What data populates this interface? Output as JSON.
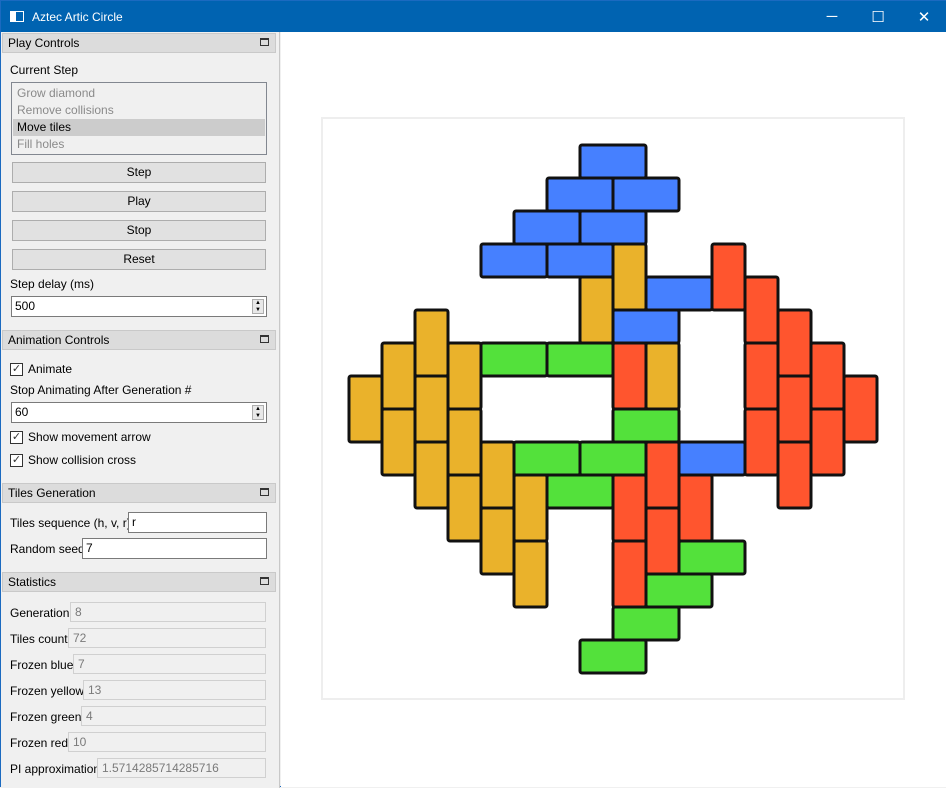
{
  "window": {
    "title": "Aztec Artic Circle",
    "minimize": "─",
    "maximize": "☐",
    "close": "✕"
  },
  "play_controls": {
    "header": "Play Controls",
    "current_step_label": "Current Step",
    "steps": [
      {
        "label": "Grow diamond",
        "selected": false
      },
      {
        "label": "Remove collisions",
        "selected": false
      },
      {
        "label": "Move tiles",
        "selected": true
      },
      {
        "label": "Fill holes",
        "selected": false
      }
    ],
    "step": "Step",
    "play": "Play",
    "stop": "Stop",
    "reset": "Reset",
    "step_delay_label": "Step delay (ms)",
    "step_delay": "500"
  },
  "animation_controls": {
    "header": "Animation Controls",
    "animate": "Animate",
    "animate_checked": true,
    "stop_after_label": "Stop Animating After Generation #",
    "stop_after": "60",
    "show_arrow": "Show movement arrow",
    "show_arrow_checked": true,
    "show_cross": "Show collision cross",
    "show_cross_checked": true
  },
  "tiles_generation": {
    "header": "Tiles Generation",
    "sequence_label": "Tiles sequence (h, v, r)",
    "sequence": "r",
    "seed_label": "Random seed",
    "seed": "7"
  },
  "statistics": {
    "header": "Statistics",
    "generation_label": "Generation",
    "generation": "8",
    "tiles_count_label": "Tiles count",
    "tiles_count": "72",
    "frozen_blue_label": "Frozen blue",
    "frozen_blue": "7",
    "frozen_yellow_label": "Frozen yellow",
    "frozen_yellow": "13",
    "frozen_green_label": "Frozen green",
    "frozen_green": "4",
    "frozen_red_label": "Frozen red",
    "frozen_red": "10",
    "pi_label": "PI approximation",
    "pi": "1.5714285714285716"
  },
  "colors": {
    "blue": "#4680ff",
    "yellow": "#eab22b",
    "green": "#53e13b",
    "red": "#ff552e",
    "accent": "#0063b1"
  },
  "board": {
    "size": 16,
    "tiles": [
      {
        "c": "blue",
        "col": 7,
        "row": 0,
        "o": "h"
      },
      {
        "c": "blue",
        "col": 6,
        "row": 1,
        "o": "h"
      },
      {
        "c": "blue",
        "col": 8,
        "row": 1,
        "o": "h"
      },
      {
        "c": "blue",
        "col": 5,
        "row": 2,
        "o": "h"
      },
      {
        "c": "blue",
        "col": 7,
        "row": 2,
        "o": "h"
      },
      {
        "c": "blue",
        "col": 4,
        "row": 3,
        "o": "h"
      },
      {
        "c": "blue",
        "col": 6,
        "row": 3,
        "o": "h"
      },
      {
        "c": "blue",
        "col": 9,
        "row": 4,
        "o": "h"
      },
      {
        "c": "blue",
        "col": 8,
        "row": 5,
        "o": "h"
      },
      {
        "c": "blue",
        "col": 10,
        "row": 9,
        "o": "h"
      },
      {
        "c": "yellow",
        "col": 8,
        "row": 3,
        "o": "v"
      },
      {
        "c": "yellow",
        "col": 7,
        "row": 4,
        "o": "v"
      },
      {
        "c": "yellow",
        "col": 2,
        "row": 5,
        "o": "v"
      },
      {
        "c": "yellow",
        "col": 1,
        "row": 6,
        "o": "v"
      },
      {
        "c": "yellow",
        "col": 3,
        "row": 6,
        "o": "v"
      },
      {
        "c": "yellow",
        "col": 9,
        "row": 6,
        "o": "v"
      },
      {
        "c": "yellow",
        "col": 0,
        "row": 7,
        "o": "v"
      },
      {
        "c": "yellow",
        "col": 2,
        "row": 7,
        "o": "v"
      },
      {
        "c": "yellow",
        "col": 1,
        "row": 8,
        "o": "v"
      },
      {
        "c": "yellow",
        "col": 3,
        "row": 8,
        "o": "v"
      },
      {
        "c": "yellow",
        "col": 2,
        "row": 9,
        "o": "v"
      },
      {
        "c": "yellow",
        "col": 4,
        "row": 9,
        "o": "v"
      },
      {
        "c": "yellow",
        "col": 3,
        "row": 10,
        "o": "v"
      },
      {
        "c": "yellow",
        "col": 5,
        "row": 10,
        "o": "v"
      },
      {
        "c": "yellow",
        "col": 4,
        "row": 11,
        "o": "v"
      },
      {
        "c": "yellow",
        "col": 5,
        "row": 12,
        "o": "v"
      },
      {
        "c": "green",
        "col": 4,
        "row": 6,
        "o": "h"
      },
      {
        "c": "green",
        "col": 6,
        "row": 6,
        "o": "h"
      },
      {
        "c": "green",
        "col": 8,
        "row": 8,
        "o": "h"
      },
      {
        "c": "green",
        "col": 5,
        "row": 9,
        "o": "h"
      },
      {
        "c": "green",
        "col": 7,
        "row": 9,
        "o": "h"
      },
      {
        "c": "green",
        "col": 6,
        "row": 10,
        "o": "h"
      },
      {
        "c": "green",
        "col": 10,
        "row": 12,
        "o": "h"
      },
      {
        "c": "green",
        "col": 9,
        "row": 13,
        "o": "h"
      },
      {
        "c": "green",
        "col": 8,
        "row": 14,
        "o": "h"
      },
      {
        "c": "green",
        "col": 7,
        "row": 15,
        "o": "h"
      },
      {
        "c": "red",
        "col": 11,
        "row": 3,
        "o": "v"
      },
      {
        "c": "red",
        "col": 12,
        "row": 4,
        "o": "v"
      },
      {
        "c": "red",
        "col": 12,
        "row": 6,
        "o": "v"
      },
      {
        "c": "red",
        "col": 12,
        "row": 8,
        "o": "v"
      },
      {
        "c": "red",
        "col": 13,
        "row": 5,
        "o": "v"
      },
      {
        "c": "red",
        "col": 13,
        "row": 7,
        "o": "v"
      },
      {
        "c": "red",
        "col": 13,
        "row": 9,
        "o": "v"
      },
      {
        "c": "red",
        "col": 14,
        "row": 6,
        "o": "v"
      },
      {
        "c": "red",
        "col": 14,
        "row": 8,
        "o": "v"
      },
      {
        "c": "red",
        "col": 15,
        "row": 7,
        "o": "v"
      },
      {
        "c": "red",
        "col": 8,
        "row": 6,
        "o": "v"
      },
      {
        "c": "red",
        "col": 9,
        "row": 9,
        "o": "v"
      },
      {
        "c": "red",
        "col": 8,
        "row": 10,
        "o": "v"
      },
      {
        "c": "red",
        "col": 10,
        "row": 10,
        "o": "v"
      },
      {
        "c": "red",
        "col": 9,
        "row": 11,
        "o": "v"
      },
      {
        "c": "red",
        "col": 8,
        "row": 12,
        "o": "v"
      }
    ]
  }
}
